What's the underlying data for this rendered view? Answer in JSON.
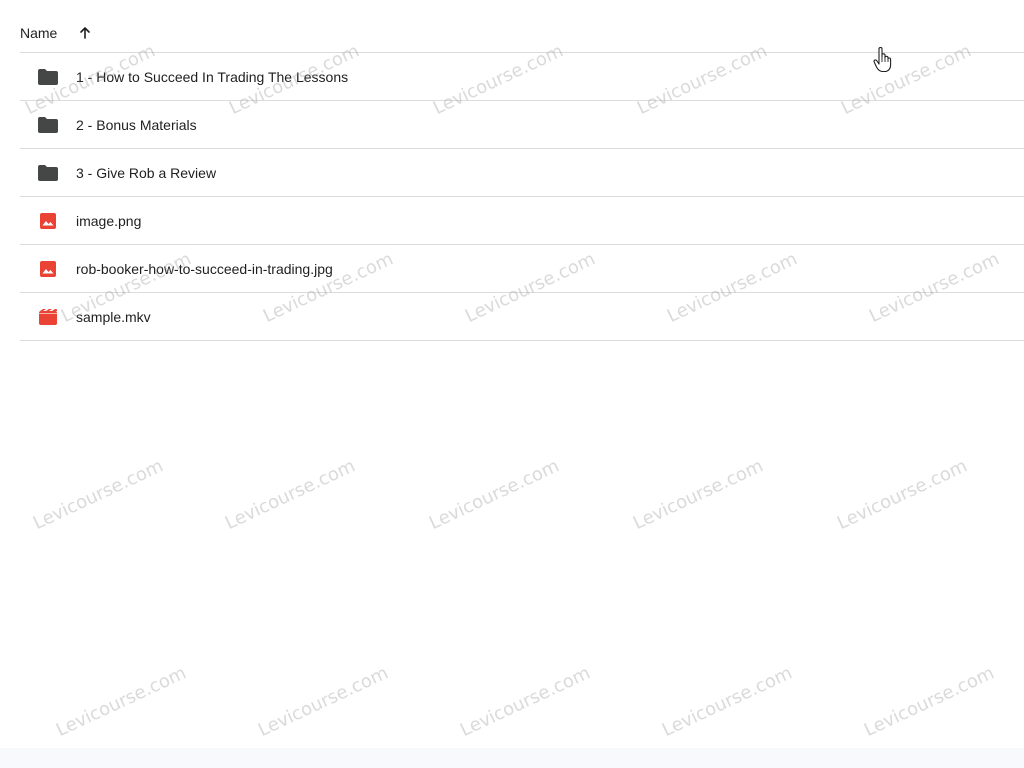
{
  "header": {
    "name_label": "Name",
    "sort_icon": "arrow-up-icon"
  },
  "files": [
    {
      "name": "1 - How to Succeed In Trading The Lessons",
      "type": "folder",
      "icon": "folder-icon"
    },
    {
      "name": "2 - Bonus Materials",
      "type": "folder",
      "icon": "folder-icon"
    },
    {
      "name": "3 - Give Rob a Review",
      "type": "folder",
      "icon": "folder-icon"
    },
    {
      "name": "image.png",
      "type": "image",
      "icon": "image-file-icon"
    },
    {
      "name": "rob-booker-how-to-succeed-in-trading.jpg",
      "type": "image",
      "icon": "image-file-icon"
    },
    {
      "name": "sample.mkv",
      "type": "video",
      "icon": "video-file-icon"
    }
  ],
  "watermark": {
    "text": "Levicourse.com"
  },
  "colors": {
    "folder": "#444746",
    "image": "#ea4335",
    "video": "#ea4335",
    "divider": "#dadce0"
  }
}
